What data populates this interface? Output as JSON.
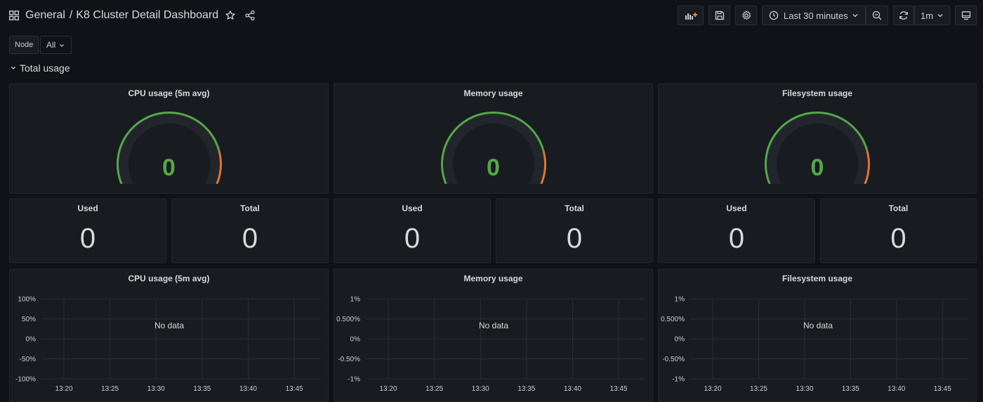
{
  "header": {
    "folder": "General",
    "separator": "/",
    "title": "K8 Cluster Detail Dashboard",
    "time_range": "Last 30 minutes",
    "refresh_interval": "1m"
  },
  "variables": {
    "node_label": "Node",
    "node_value": "All"
  },
  "row": {
    "title": "Total usage"
  },
  "gauges": [
    {
      "title": "CPU usage (5m avg)",
      "value": "0"
    },
    {
      "title": "Memory usage",
      "value": "0"
    },
    {
      "title": "Filesystem usage",
      "value": "0"
    }
  ],
  "stats": [
    {
      "title": "Used",
      "value": "0"
    },
    {
      "title": "Total",
      "value": "0"
    },
    {
      "title": "Used",
      "value": "0"
    },
    {
      "title": "Total",
      "value": "0"
    },
    {
      "title": "Used",
      "value": "0"
    },
    {
      "title": "Total",
      "value": "0"
    }
  ],
  "timeseries": [
    {
      "title": "CPU usage (5m avg)",
      "no_data": "No data"
    },
    {
      "title": "Memory usage",
      "no_data": "No data"
    },
    {
      "title": "Filesystem usage",
      "no_data": "No data"
    }
  ],
  "colors": {
    "background": "#111217",
    "panel": "#181b1f",
    "gauge_green": "#56a64b",
    "gauge_orange": "#e0752d"
  },
  "icons": [
    "dashboards-grid-icon",
    "star-icon",
    "share-icon",
    "add-panel-icon",
    "save-icon",
    "settings-gear-icon",
    "clock-icon",
    "chevron-down-icon",
    "zoom-out-icon",
    "refresh-icon",
    "tv-mode-icon"
  ],
  "chart_data": [
    {
      "type": "line",
      "title": "CPU usage (5m avg)",
      "x": [
        "13:20",
        "13:25",
        "13:30",
        "13:35",
        "13:40",
        "13:45"
      ],
      "y_ticks": [
        "100%",
        "50%",
        "0%",
        "-50%",
        "-100%"
      ],
      "series": [],
      "grid": true
    },
    {
      "type": "line",
      "title": "Memory usage",
      "x": [
        "13:20",
        "13:25",
        "13:30",
        "13:35",
        "13:40",
        "13:45"
      ],
      "y_ticks": [
        "1%",
        "0.500%",
        "0%",
        "-0.50%",
        "-1%"
      ],
      "series": [],
      "grid": true
    },
    {
      "type": "line",
      "title": "Filesystem usage",
      "x": [
        "13:20",
        "13:25",
        "13:30",
        "13:35",
        "13:40",
        "13:45"
      ],
      "y_ticks": [
        "1%",
        "0.500%",
        "0%",
        "-0.50%",
        "-1%"
      ],
      "series": [],
      "grid": true
    }
  ]
}
